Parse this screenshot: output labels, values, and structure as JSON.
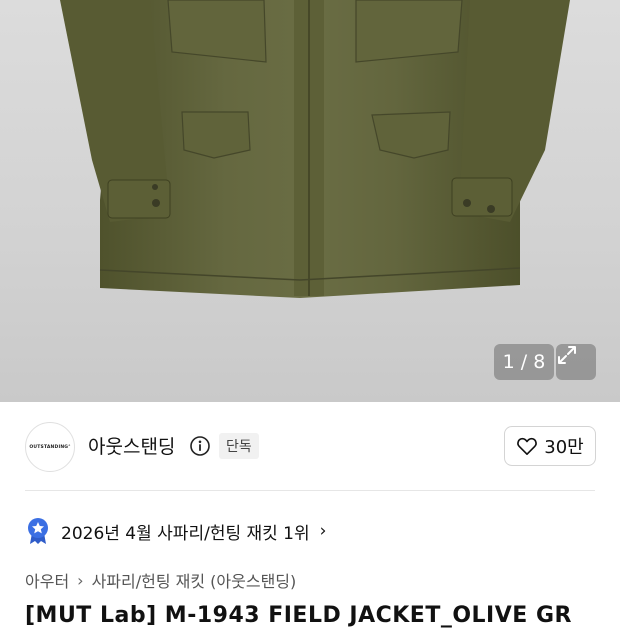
{
  "gallery": {
    "counter": "1 / 8",
    "expand_icon": "expand-icon"
  },
  "brand": {
    "logo_text": "OUTSTANDING°",
    "name": "아웃스탠딩",
    "info_icon": "info-icon",
    "exclusive_badge": "단독",
    "like_icon": "heart-icon",
    "like_count": "30만"
  },
  "ranking": {
    "badge_icon": "ranking-star-badge-icon",
    "text": "2026년 4월 사파리/헌팅 재킷 1위",
    "chevron": "›"
  },
  "breadcrumb": {
    "items": [
      "아우터",
      "사파리/헌팅 재킷 (아웃스탠딩)"
    ],
    "separator": "›"
  },
  "product": {
    "title": "[MUT Lab] M-1943 FIELD JACKET_OLIVE GR"
  },
  "colors": {
    "jacket": "#5f6238",
    "rank_badge": "#3b6fe3"
  }
}
